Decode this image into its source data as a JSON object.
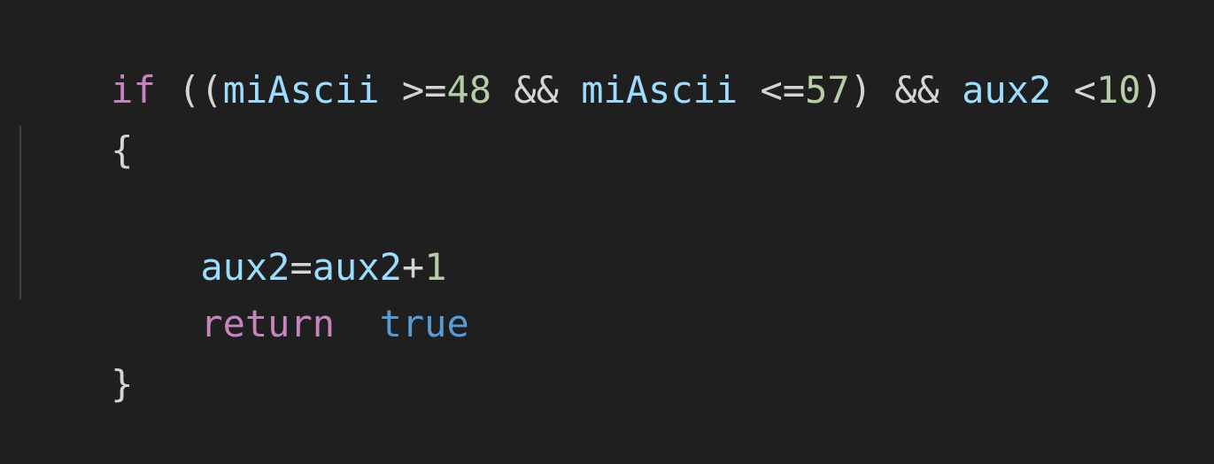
{
  "editor": {
    "lines": [
      {
        "tokens": [
          {
            "text": "if",
            "kind": "kw"
          },
          {
            "text": " ((",
            "kind": "punc"
          },
          {
            "text": "miAscii",
            "kind": "var"
          },
          {
            "text": " >=",
            "kind": "op"
          },
          {
            "text": "48",
            "kind": "num"
          },
          {
            "text": " && ",
            "kind": "op"
          },
          {
            "text": "miAscii",
            "kind": "var"
          },
          {
            "text": " <=",
            "kind": "op"
          },
          {
            "text": "57",
            "kind": "num"
          },
          {
            "text": ") && ",
            "kind": "op"
          },
          {
            "text": "aux2",
            "kind": "var"
          },
          {
            "text": " <",
            "kind": "op"
          },
          {
            "text": "10",
            "kind": "num"
          },
          {
            "text": ")",
            "kind": "punc"
          }
        ]
      },
      {
        "tokens": [
          {
            "text": "{",
            "kind": "punc"
          }
        ]
      },
      {
        "tokens": []
      },
      {
        "tokens": [
          {
            "text": "    ",
            "kind": "punc"
          },
          {
            "text": "aux2",
            "kind": "var"
          },
          {
            "text": "=",
            "kind": "op"
          },
          {
            "text": "aux2",
            "kind": "var"
          },
          {
            "text": "+",
            "kind": "op"
          },
          {
            "text": "1",
            "kind": "num"
          }
        ]
      },
      {
        "tokens": [
          {
            "text": "    ",
            "kind": "punc"
          },
          {
            "text": "return",
            "kind": "kw"
          },
          {
            "text": "  ",
            "kind": "punc"
          },
          {
            "text": "true",
            "kind": "const"
          }
        ]
      },
      {
        "tokens": [
          {
            "text": "}",
            "kind": "punc"
          }
        ]
      }
    ]
  }
}
